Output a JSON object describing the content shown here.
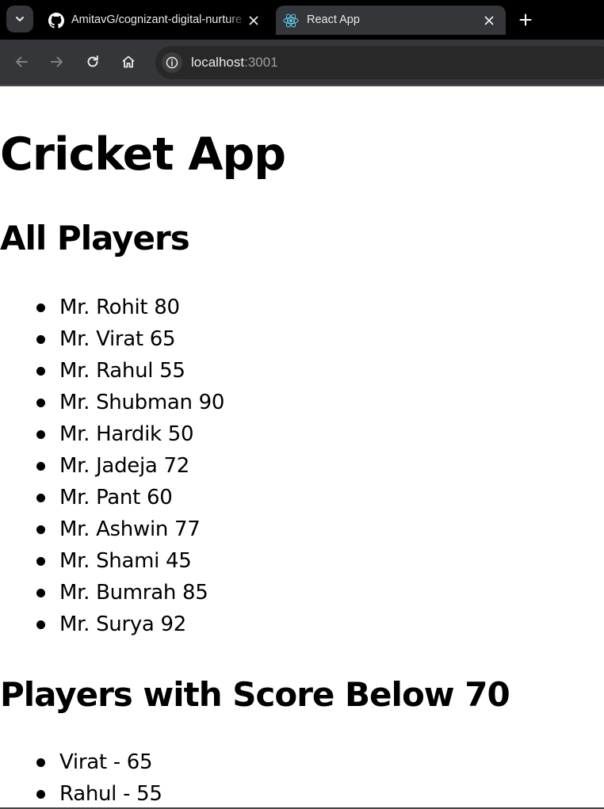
{
  "browser": {
    "tabs": [
      {
        "title": "AmitavG/cognizant-digital-nurture",
        "icon": "github-icon",
        "active": false
      },
      {
        "title": "React App",
        "icon": "react-icon",
        "active": true
      }
    ],
    "address": {
      "host": "localhost",
      "port": ":3001"
    },
    "colors": {
      "tabbar": "#000000",
      "toolbar": "#35363a",
      "omnibox": "#282828",
      "text": "#e8eaed"
    }
  },
  "page": {
    "title": "Cricket App",
    "all_players": {
      "heading": "All Players",
      "items": [
        "Mr. Rohit 80",
        "Mr. Virat 65",
        "Mr. Rahul 55",
        "Mr. Shubman 90",
        "Mr. Hardik 50",
        "Mr. Jadeja 72",
        "Mr. Pant 60",
        "Mr. Ashwin 77",
        "Mr. Shami 45",
        "Mr. Bumrah 85",
        "Mr. Surya 92"
      ]
    },
    "below_70": {
      "heading": "Players with Score Below 70",
      "items": [
        "Virat - 65",
        "Rahul - 55"
      ]
    }
  }
}
